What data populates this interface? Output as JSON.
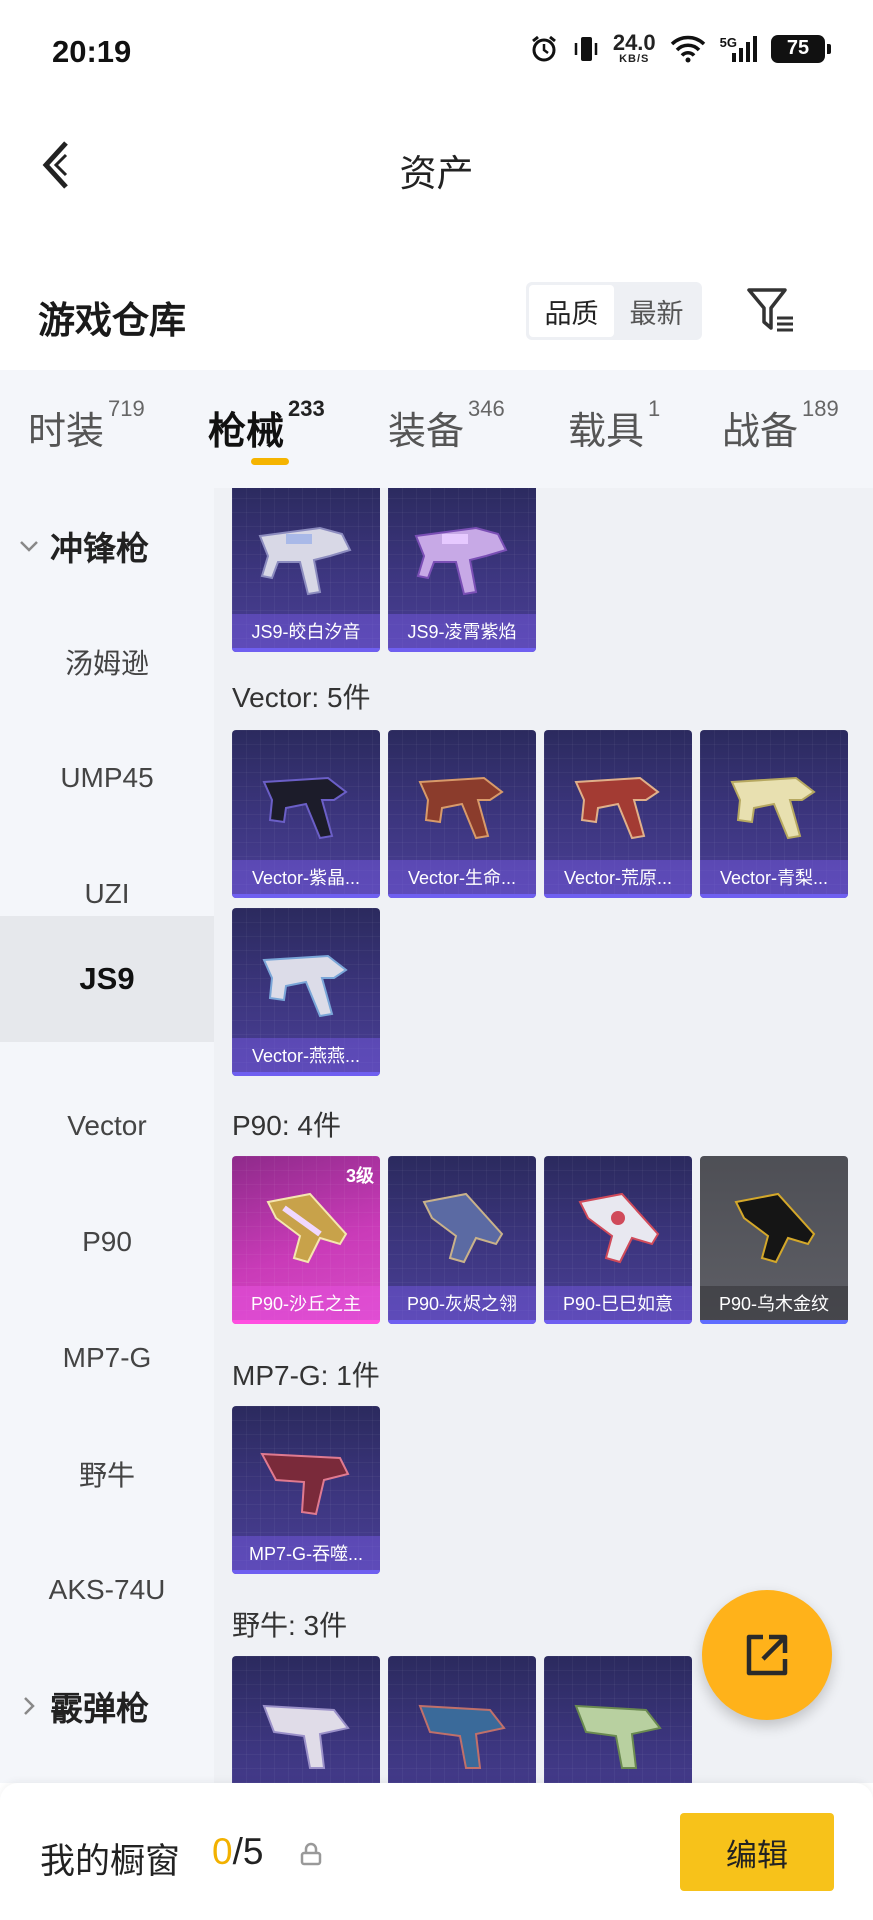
{
  "status": {
    "time": "20:19",
    "net_speed": "24.0",
    "net_unit": "KB/S",
    "signal_label": "5G",
    "battery": "75"
  },
  "nav": {
    "title": "资产"
  },
  "header": {
    "title": "游戏仓库",
    "sort_options": [
      "品质",
      "最新"
    ],
    "sort_active": "品质"
  },
  "tabs": [
    {
      "label": "时装",
      "count": "719"
    },
    {
      "label": "枪械",
      "count": "233"
    },
    {
      "label": "装备",
      "count": "346"
    },
    {
      "label": "载具",
      "count": "1"
    },
    {
      "label": "战备",
      "count": "189"
    }
  ],
  "active_tab": "枪械",
  "sidebar": {
    "category_1": "冲锋枪",
    "items": [
      "汤姆逊",
      "UMP45",
      "UZI",
      "JS9",
      "Vector",
      "P90",
      "MP7-G",
      "野牛",
      "AKS-74U"
    ],
    "active_item": "JS9",
    "category_2": "霰弹枪"
  },
  "groups": {
    "js9": {
      "cards": [
        "JS9-皎白汐音",
        "JS9-凌霄紫焰"
      ]
    },
    "vector": {
      "label": "Vector: 5件",
      "cards": [
        "Vector-紫晶...",
        "Vector-生命...",
        "Vector-荒原...",
        "Vector-青梨...",
        "Vector-燕燕..."
      ]
    },
    "p90": {
      "label": "P90: 4件",
      "cards": [
        "P90-沙丘之主",
        "P90-灰烬之翎",
        "P90-巳巳如意",
        "P90-乌木金纹"
      ],
      "level_badge": "3级"
    },
    "mp7": {
      "label": "MP7-G: 1件",
      "cards": [
        "MP7-G-吞噬..."
      ]
    },
    "bison": {
      "label": "野牛: 3件"
    }
  },
  "footer": {
    "showcase_label": "我的橱窗",
    "showcase_current": "0",
    "showcase_total": "/5",
    "edit_label": "编辑"
  },
  "colors": {
    "accent": "#f7c21a",
    "card_epic": "#3d3680",
    "card_legend": "#c93bb8",
    "card_common": "#5e5f66"
  }
}
